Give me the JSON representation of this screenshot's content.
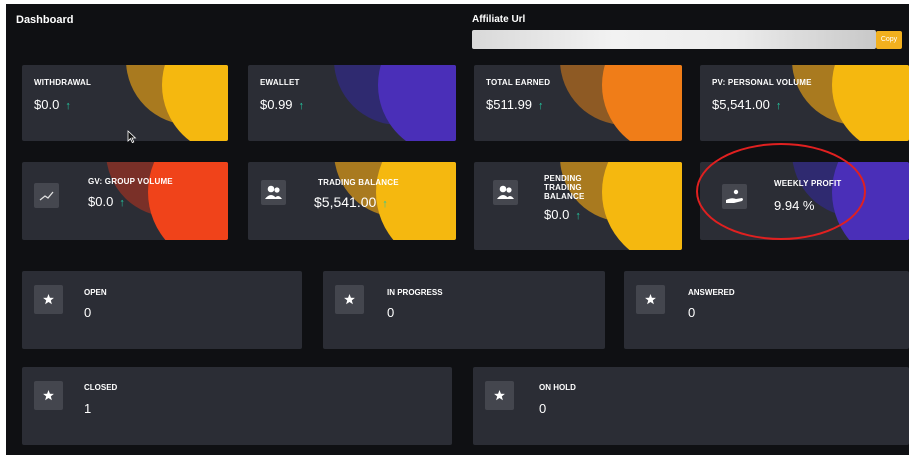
{
  "header": {
    "title": "Dashboard",
    "affiliate_label": "Affiliate Url",
    "copy_label": "Copy"
  },
  "stats": [
    {
      "label": "WITHDRAWAL",
      "value": "$0.0",
      "trend": "up"
    },
    {
      "label": "EWALLET",
      "value": "$0.99",
      "trend": "up"
    },
    {
      "label": "TOTAL EARNED",
      "value": "$511.99",
      "trend": "up"
    },
    {
      "label": "PV: PERSONAL VOLUME",
      "value": "$5,541.00",
      "trend": "up"
    },
    {
      "label": "GV: GROUP VOLUME",
      "value": "$0.0",
      "trend": "up",
      "icon": "chart-line-icon"
    },
    {
      "label": "TRADING BALANCE",
      "value": "$5,541.00",
      "trend": "up",
      "icon": "users-icon"
    },
    {
      "label": "PENDING TRADING BALANCE",
      "value": "$0.0",
      "trend": "up",
      "icon": "users-icon"
    },
    {
      "label": "WEEKLY PROFIT",
      "value": "9.94 %",
      "icon": "hand-coin-icon"
    }
  ],
  "tickets": [
    {
      "label": "OPEN",
      "value": "0",
      "icon": "star-icon"
    },
    {
      "label": "IN PROGRESS",
      "value": "0",
      "icon": "star-icon"
    },
    {
      "label": "ANSWERED",
      "value": "0",
      "icon": "star-icon"
    },
    {
      "label": "CLOSED",
      "value": "1",
      "icon": "star-icon"
    },
    {
      "label": "ON HOLD",
      "value": "0",
      "icon": "star-icon"
    }
  ],
  "colors": {
    "background": "#0f1013",
    "card": "#2b2d35",
    "accent_yellow": "#f5b80f",
    "accent_orange": "#f07d18",
    "accent_purple": "#4a2fb8",
    "accent_red": "#f0431a",
    "trend_up": "#23c9a1",
    "highlight": "#e02020"
  }
}
